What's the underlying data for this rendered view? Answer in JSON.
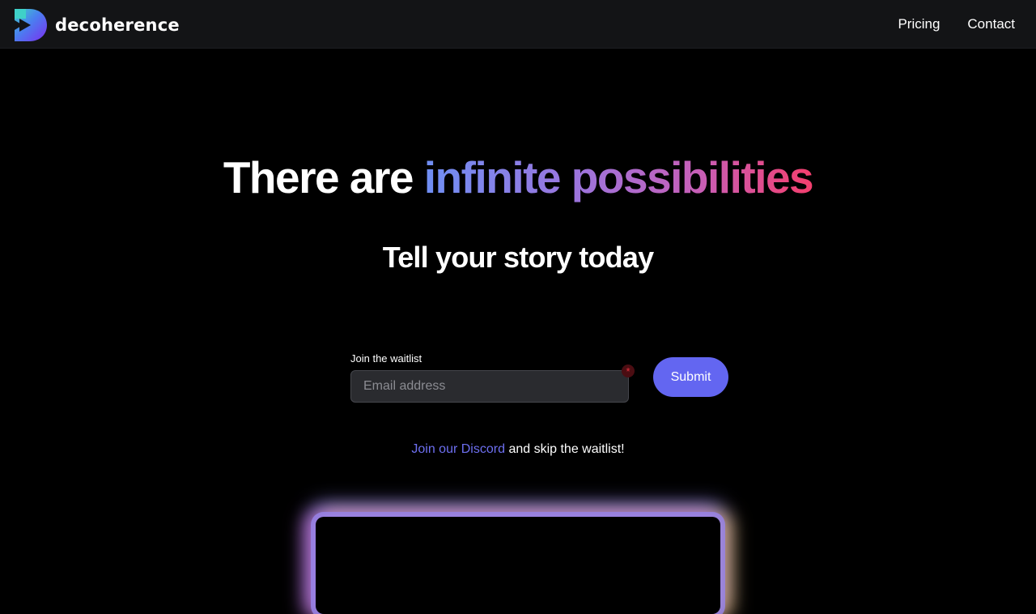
{
  "header": {
    "brand_name": "decoherence",
    "logo_icon": "decoherence-logo-icon",
    "nav": [
      {
        "label": "Pricing"
      },
      {
        "label": "Contact"
      }
    ]
  },
  "hero": {
    "title_plain": "There are",
    "title_gradient": "infinite possibilities",
    "subtitle": "Tell your story today"
  },
  "waitlist": {
    "label": "Join the waitlist",
    "email_placeholder": "Email address",
    "email_value": "",
    "required_marker": "*",
    "submit_label": "Submit"
  },
  "discord": {
    "link_text": "Join our Discord",
    "suffix_text": "and skip the waitlist!"
  },
  "colors": {
    "background": "#000000",
    "header_bg": "#131416",
    "accent": "#6366f1",
    "gradient_start": "#6f8ff4",
    "gradient_end": "#f43f6e",
    "link": "#6d6ff0",
    "required": "#e2323f"
  }
}
